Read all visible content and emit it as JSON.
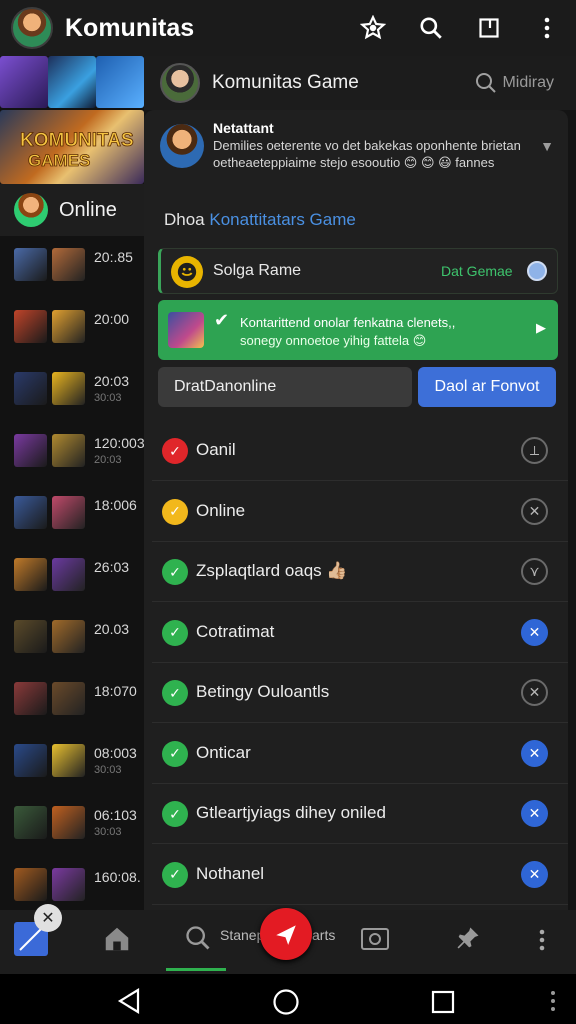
{
  "topbar": {
    "title": "Komunitas"
  },
  "leftcol": {
    "online_label": "Online",
    "rows": [
      {
        "time": "20:.85",
        "sub": ""
      },
      {
        "time": "20:00",
        "sub": ""
      },
      {
        "time": "20:03",
        "sub": "30:03"
      },
      {
        "time": "120:003",
        "sub": "20:03"
      },
      {
        "time": "18:006",
        "sub": ""
      },
      {
        "time": "26:03",
        "sub": ""
      },
      {
        "time": "20.03",
        "sub": ""
      },
      {
        "time": "18:070",
        "sub": ""
      },
      {
        "time": "08:003",
        "sub": "30:03"
      },
      {
        "time": "06:103",
        "sub": "30:03"
      },
      {
        "time": "160:08.",
        "sub": ""
      }
    ]
  },
  "chat_header": {
    "title": "Komunitas Game",
    "search_placeholder": "Midiray"
  },
  "notice": {
    "title": "Netattant",
    "body": "Demilies oeterente vo det bakekas oponhente brietan oetheaeteppiaime stejo esooutio 😊 😊 😃 fannes"
  },
  "section": {
    "prefix": "Dhoa ",
    "link": "Konattitatars Game"
  },
  "game_row": {
    "label": "Solga Rame",
    "status": "Dat Gemae"
  },
  "promo": {
    "line1": "Kontarittend onolar fenkatna clenets,,",
    "line2": "sonegy onnoetoe yihig fattela 😊"
  },
  "field": {
    "value": "DratDanonline"
  },
  "cta": {
    "label": "Daol ar Fonvot"
  },
  "items": [
    {
      "label": "Oanil",
      "dot_color": "#e0262a",
      "action": "outline",
      "glyph": "⟂"
    },
    {
      "label": "Online",
      "dot_color": "#f2b81c",
      "action": "outline",
      "glyph": "✕"
    },
    {
      "label": "Zsplaqtlard oaqs 👍🏼",
      "dot_color": "#2fb24f",
      "action": "outline",
      "glyph": "⋎"
    },
    {
      "label": "Cotratimat",
      "dot_color": "#2fb24f",
      "action": "blue",
      "glyph": "✕"
    },
    {
      "label": "Betingy Ouloantls",
      "dot_color": "#2fb24f",
      "action": "outline",
      "glyph": "✕"
    },
    {
      "label": "Onticar",
      "dot_color": "#2fb24f",
      "action": "blue",
      "glyph": "✕"
    },
    {
      "label": "Gtleartjyiags dihey oniled",
      "dot_color": "#2fb24f",
      "action": "blue",
      "glyph": "✕"
    },
    {
      "label": "Nothanel",
      "dot_color": "#2fb24f",
      "action": "blue",
      "glyph": "✕"
    }
  ],
  "bottomnav": {
    "search_label": "Stanep",
    "search_label2": "arts"
  },
  "colors": {
    "accent_blue": "#3d6fd8",
    "green": "#2ea352",
    "red_fab": "#e31b23"
  }
}
